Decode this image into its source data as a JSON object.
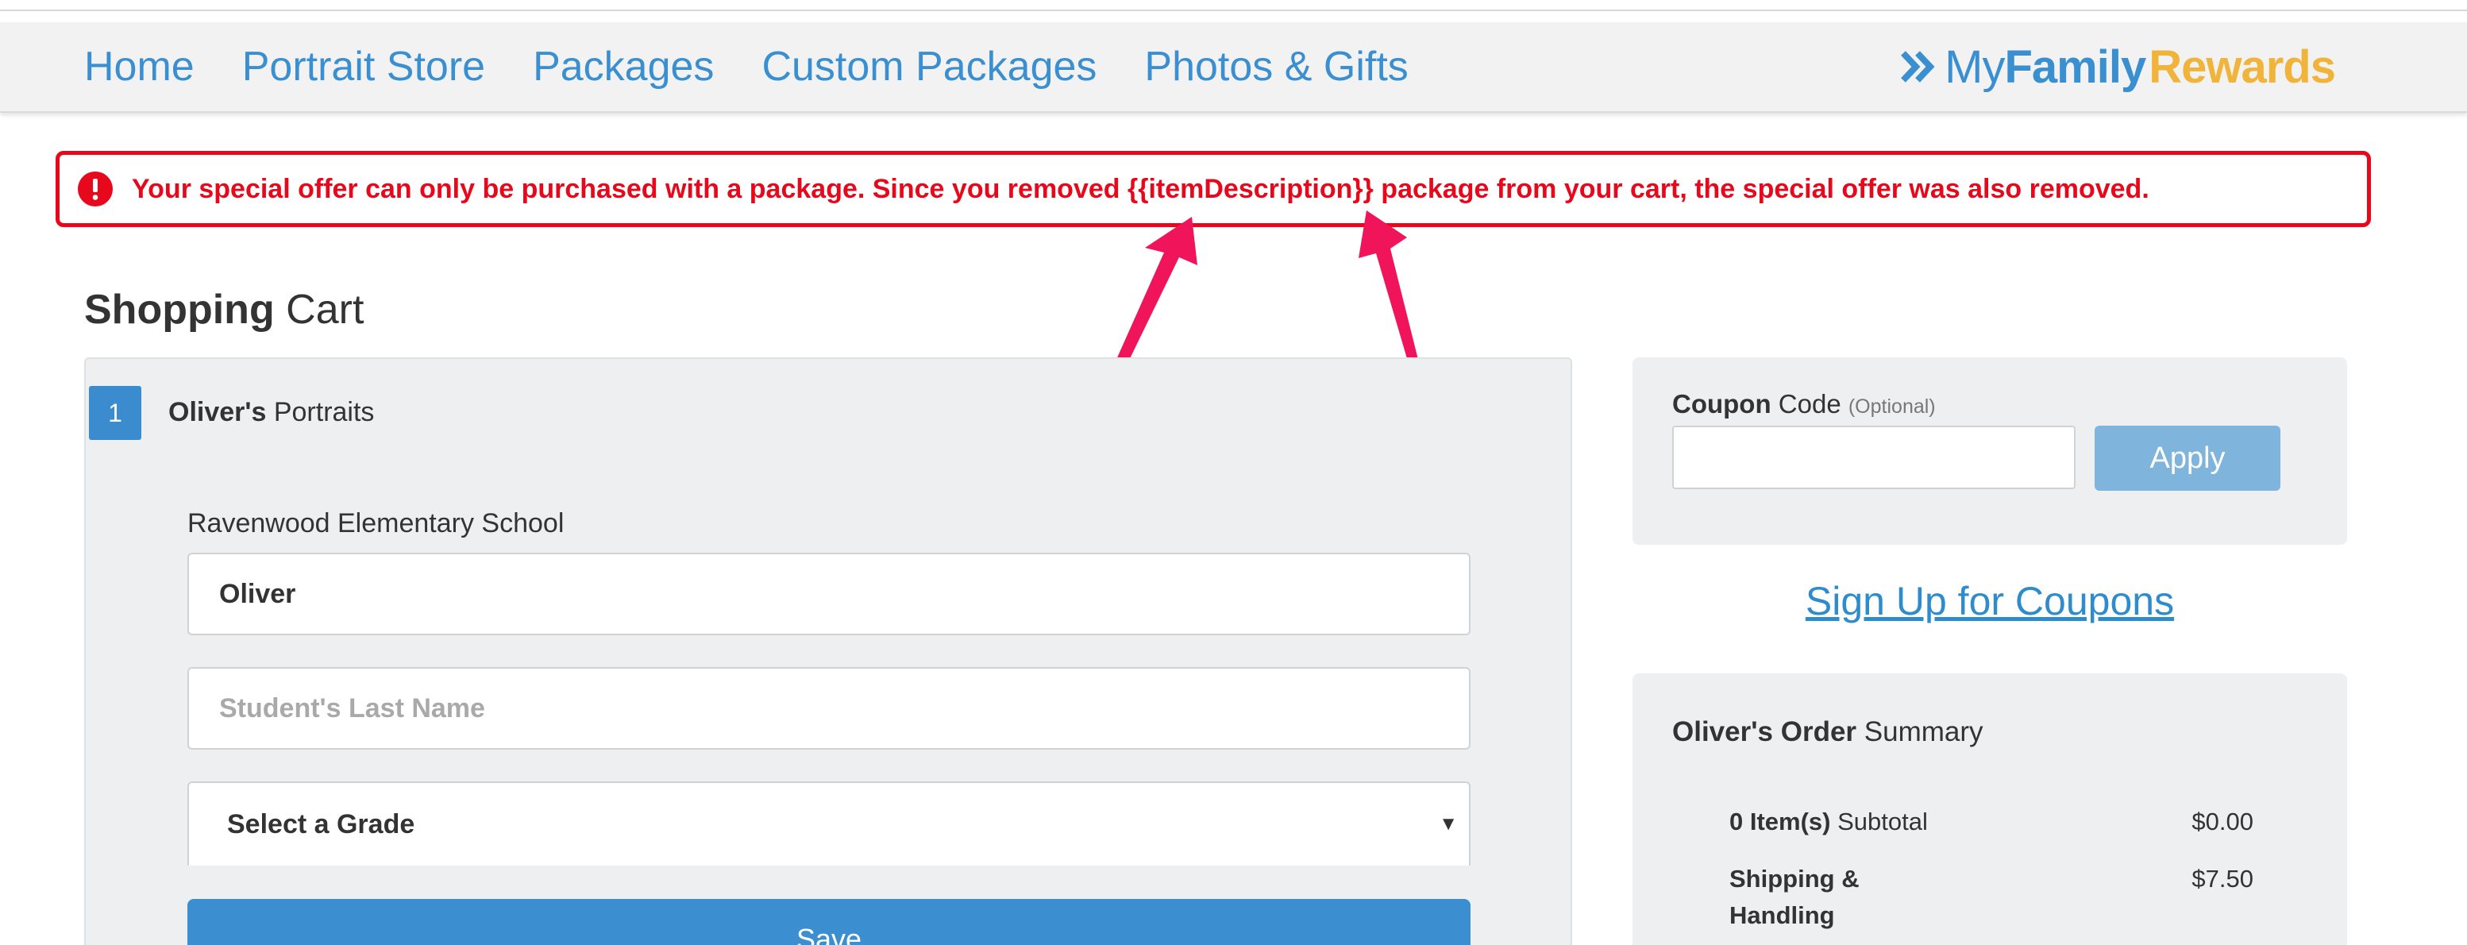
{
  "nav": {
    "links": [
      "Home",
      "Portrait Store",
      "Packages",
      "Custom Packages",
      "Photos & Gifts"
    ]
  },
  "brand": {
    "my": "My",
    "family": "Family",
    "rewards": "Rewards",
    "icon": "double-chevron-right-icon"
  },
  "alert": {
    "icon": "exclamation-circle-icon",
    "message": "Your special offer can only be purchased with a package. Since you removed {{itemDescription}} package from your cart, the special offer was also removed."
  },
  "page": {
    "title_bold": "Shopping",
    "title_rest": "Cart"
  },
  "cart": {
    "step_number": "1",
    "student_bold": "Oliver's",
    "student_rest": "Portraits",
    "school": "Ravenwood Elementary School",
    "first_name_value": "Oliver",
    "last_name_placeholder": "Student's Last Name",
    "grade_placeholder": "Select a Grade",
    "save_label": "Save"
  },
  "coupon": {
    "label_bold": "Coupon",
    "label_rest": "Code",
    "optional": "(Optional)",
    "input_value": "",
    "apply_label": "Apply"
  },
  "signup": {
    "label": "Sign Up for Coupons"
  },
  "summary": {
    "title_bold": "Oliver's Order",
    "title_rest": "Summary",
    "subtotal_bold": "0 Item(s)",
    "subtotal_rest": "Subtotal",
    "subtotal_value": "$0.00",
    "shipping_label": "Shipping & Handling",
    "shipping_value": "$7.50"
  },
  "colors": {
    "nav_link": "#3a8fd0",
    "brand_rewards": "#f0b43a",
    "alert_red": "#e8081b",
    "annotation_arrow": "#f0145a",
    "save_button": "#3b8fd0",
    "apply_button": "#7fb5dc"
  }
}
